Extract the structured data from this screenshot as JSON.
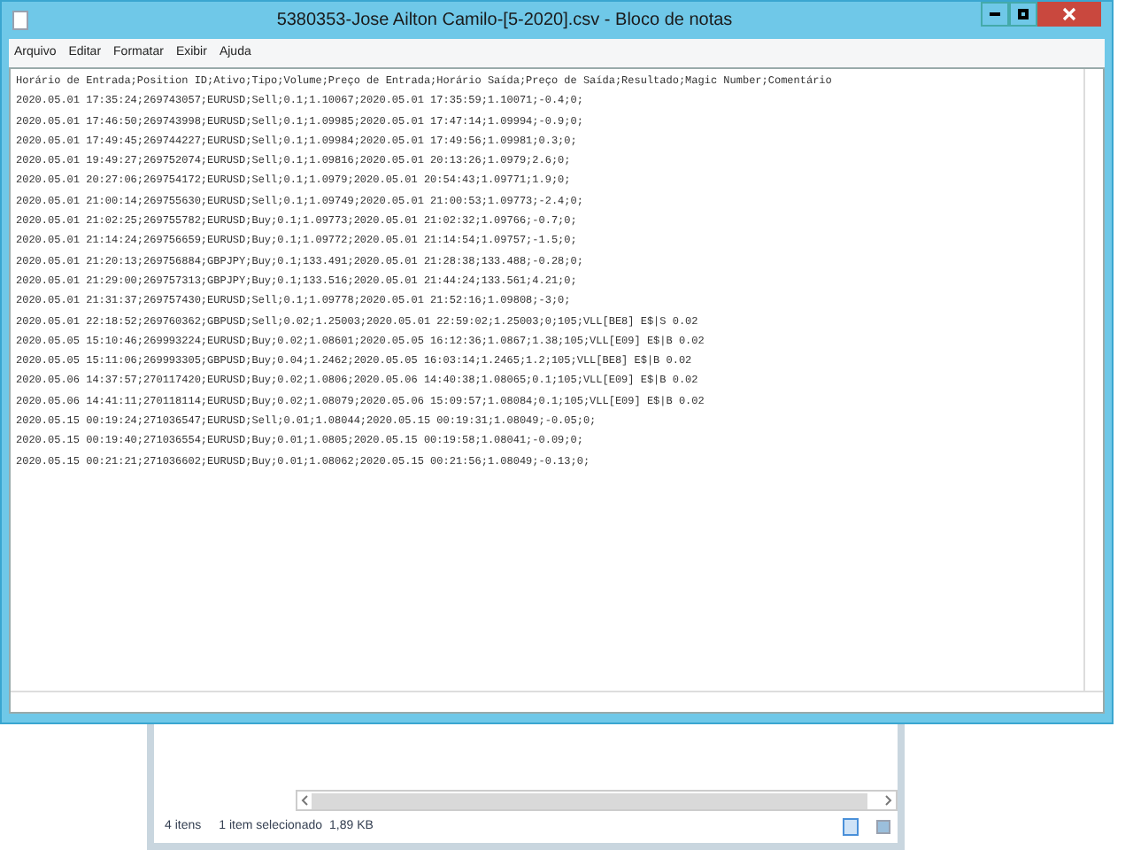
{
  "window": {
    "title": "5380353-Jose Ailton Camilo-[5-2020].csv - Bloco de notas"
  },
  "menu": [
    "Arquivo",
    "Editar",
    "Formatar",
    "Exibir",
    "Ajuda"
  ],
  "lines": [
    "Horário de Entrada;Position ID;Ativo;Tipo;Volume;Preço de Entrada;Horário Saída;Preço de Saída;Resultado;Magic Number;Comentário",
    "2020.05.01 17:35:24;269743057;EURUSD;Sell;0.1;1.10067;2020.05.01 17:35:59;1.10071;-0.4;0;",
    "2020.05.01 17:46:50;269743998;EURUSD;Sell;0.1;1.09985;2020.05.01 17:47:14;1.09994;-0.9;0;",
    "2020.05.01 17:49:45;269744227;EURUSD;Sell;0.1;1.09984;2020.05.01 17:49:56;1.09981;0.3;0;",
    "2020.05.01 19:49:27;269752074;EURUSD;Sell;0.1;1.09816;2020.05.01 20:13:26;1.0979;2.6;0;",
    "2020.05.01 20:27:06;269754172;EURUSD;Sell;0.1;1.0979;2020.05.01 20:54:43;1.09771;1.9;0;",
    "2020.05.01 21:00:14;269755630;EURUSD;Sell;0.1;1.09749;2020.05.01 21:00:53;1.09773;-2.4;0;",
    "2020.05.01 21:02:25;269755782;EURUSD;Buy;0.1;1.09773;2020.05.01 21:02:32;1.09766;-0.7;0;",
    "2020.05.01 21:14:24;269756659;EURUSD;Buy;0.1;1.09772;2020.05.01 21:14:54;1.09757;-1.5;0;",
    "2020.05.01 21:20:13;269756884;GBPJPY;Buy;0.1;133.491;2020.05.01 21:28:38;133.488;-0.28;0;",
    "2020.05.01 21:29:00;269757313;GBPJPY;Buy;0.1;133.516;2020.05.01 21:44:24;133.561;4.21;0;",
    "2020.05.01 21:31:37;269757430;EURUSD;Sell;0.1;1.09778;2020.05.01 21:52:16;1.09808;-3;0;",
    "2020.05.01 22:18:52;269760362;GBPUSD;Sell;0.02;1.25003;2020.05.01 22:59:02;1.25003;0;105;VLL[BE8] E$|S 0.02",
    "2020.05.05 15:10:46;269993224;EURUSD;Buy;0.02;1.08601;2020.05.05 16:12:36;1.0867;1.38;105;VLL[E09] E$|B 0.02",
    "2020.05.05 15:11:06;269993305;GBPUSD;Buy;0.04;1.2462;2020.05.05 16:03:14;1.2465;1.2;105;VLL[BE8] E$|B 0.02",
    "2020.05.06 14:37:57;270117420;EURUSD;Buy;0.02;1.0806;2020.05.06 14:40:38;1.08065;0.1;105;VLL[E09] E$|B 0.02",
    "2020.05.06 14:41:11;270118114;EURUSD;Buy;0.02;1.08079;2020.05.06 15:09:57;1.08084;0.1;105;VLL[E09] E$|B 0.02",
    "2020.05.15 00:19:24;271036547;EURUSD;Sell;0.01;1.08044;2020.05.15 00:19:31;1.08049;-0.05;0;",
    "2020.05.15 00:19:40;271036554;EURUSD;Buy;0.01;1.0805;2020.05.15 00:19:58;1.08041;-0.09;0;",
    "2020.05.15 00:21:21;271036602;EURUSD;Buy;0.01;1.08062;2020.05.15 00:21:56;1.08049;-0.13;0;"
  ],
  "explorer_status": {
    "count": "4 itens",
    "selection": "1 item selecionado",
    "size": "1,89 KB"
  }
}
